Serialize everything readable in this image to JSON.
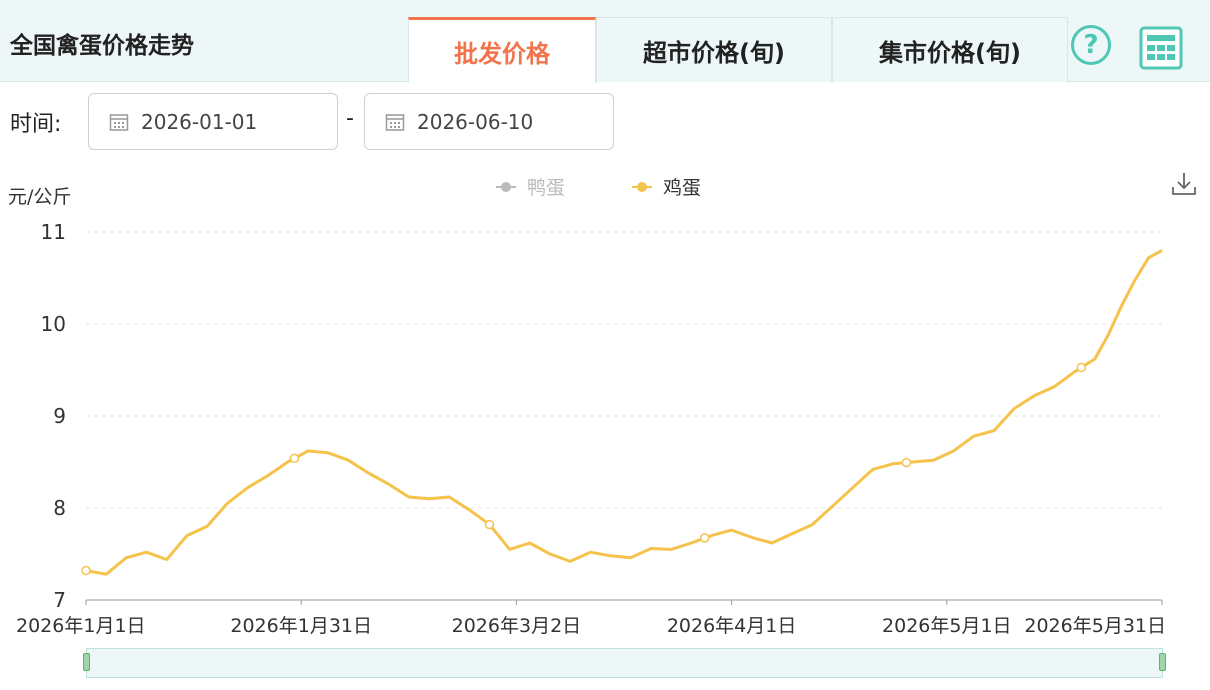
{
  "header": {
    "title": "全国禽蛋价格走势",
    "tabs": [
      {
        "label": "批发价格",
        "active": true
      },
      {
        "label": "超市价格(旬)",
        "active": false
      },
      {
        "label": "集市价格(旬)",
        "active": false
      }
    ],
    "help_icon": "?",
    "table_icon": "table-icon",
    "accent_color": "#f2744c",
    "icon_color": "#4ec7b5"
  },
  "filter": {
    "time_label": "时间:",
    "start_date": "2026-01-01",
    "separator": "-",
    "end_date": "2026-06-10"
  },
  "chart_data": {
    "type": "line",
    "ylabel": "元/公斤",
    "ylim": [
      7,
      11
    ],
    "yticks": [
      "7",
      "8",
      "9",
      "10",
      "11"
    ],
    "xtick_labels": [
      "2026年1月1日",
      "2026年1月31日",
      "2026年3月2日",
      "2026年4月1日",
      "2026年5月1日",
      "2026年5月31日"
    ],
    "legend": [
      {
        "name": "鸭蛋",
        "color": "#bbbbbb",
        "enabled": false
      },
      {
        "name": "鸡蛋",
        "color": "#f5c24c",
        "enabled": true
      }
    ],
    "legend_position": "top-center",
    "grid": true,
    "series": [
      {
        "name": "鸡蛋",
        "color": "#f5c24c",
        "x": [
          0,
          3,
          6,
          9,
          12,
          15,
          18,
          21,
          24,
          27,
          30,
          33,
          36,
          39,
          42,
          45,
          48,
          51,
          54,
          57,
          60,
          63,
          66,
          69,
          72,
          75,
          78,
          81,
          84,
          87,
          90,
          93,
          96,
          99,
          102,
          105,
          108,
          111,
          114,
          117,
          120,
          123,
          126,
          129,
          132,
          135,
          138,
          141,
          144,
          147,
          150,
          152,
          154,
          156,
          158,
          160
        ],
        "values": [
          7.32,
          7.28,
          7.46,
          7.52,
          7.44,
          7.7,
          7.8,
          8.05,
          8.22,
          8.35,
          8.5,
          8.62,
          8.6,
          8.52,
          8.38,
          8.26,
          8.12,
          8.1,
          8.12,
          7.98,
          7.82,
          7.55,
          7.62,
          7.5,
          7.42,
          7.52,
          7.48,
          7.46,
          7.56,
          7.55,
          7.62,
          7.7,
          7.76,
          7.68,
          7.62,
          7.72,
          7.82,
          8.02,
          8.22,
          8.42,
          8.48,
          8.5,
          8.52,
          8.62,
          8.78,
          8.84,
          9.08,
          9.22,
          9.32,
          9.48,
          9.62,
          9.88,
          10.2,
          10.48,
          10.72,
          10.8
        ],
        "markers_x": [
          0,
          31,
          60,
          92,
          122,
          148
        ]
      }
    ],
    "slider": {
      "start": "2026-01-01",
      "end": "2026-06-10"
    }
  }
}
